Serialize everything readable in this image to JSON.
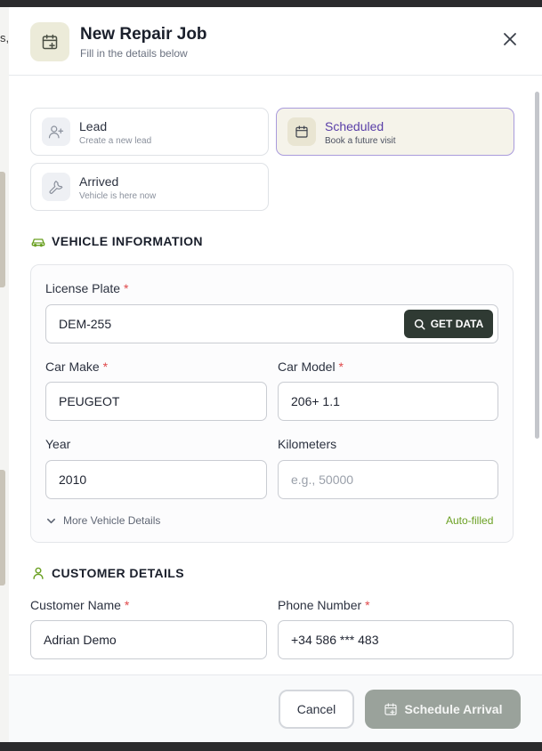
{
  "background": {
    "partial_text": "s,"
  },
  "header": {
    "title": "New Repair Job",
    "subtitle": "Fill in the details below",
    "icon": "calendar-plus-icon",
    "close_icon": "close-icon"
  },
  "job_types": [
    {
      "label": "Lead",
      "sub": "Create a new lead",
      "icon": "user-plus-icon",
      "selected": false
    },
    {
      "label": "Scheduled",
      "sub": "Book a future visit",
      "icon": "calendar-icon",
      "selected": true
    },
    {
      "label": "Arrived",
      "sub": "Vehicle is here now",
      "icon": "wrench-icon",
      "selected": false
    }
  ],
  "vehicle": {
    "section_title": "VEHICLE INFORMATION",
    "icon": "car-icon",
    "license_plate": {
      "label": "License Plate",
      "required": "*",
      "value": "DEM-255"
    },
    "get_data_label": "GET DATA",
    "car_make": {
      "label": "Car Make",
      "required": "*",
      "value": "PEUGEOT"
    },
    "car_model": {
      "label": "Car Model",
      "required": "*",
      "value": "206+ 1.1"
    },
    "year": {
      "label": "Year",
      "value": "2010"
    },
    "kilometers": {
      "label": "Kilometers",
      "value": "",
      "placeholder": "e.g., 50000"
    },
    "more_details_label": "More Vehicle Details",
    "autofilled_label": "Auto-filled"
  },
  "customer": {
    "section_title": "CUSTOMER DETAILS",
    "icon": "user-icon",
    "name": {
      "label": "Customer Name",
      "required": "*",
      "value": "Adrian Demo"
    },
    "phone": {
      "label": "Phone Number",
      "required": "*",
      "value": "+34 586 *** 483"
    }
  },
  "footer": {
    "cancel_label": "Cancel",
    "submit_label": "Schedule Arrival",
    "submit_icon": "calendar-plus-icon"
  },
  "colors": {
    "accent_green": "#6aa022",
    "selected_border": "#a99bdc",
    "selected_text": "#5a3fa8",
    "dark_button": "#2f3a33",
    "disabled_button": "#9aa29b",
    "required": "#e0484a"
  }
}
